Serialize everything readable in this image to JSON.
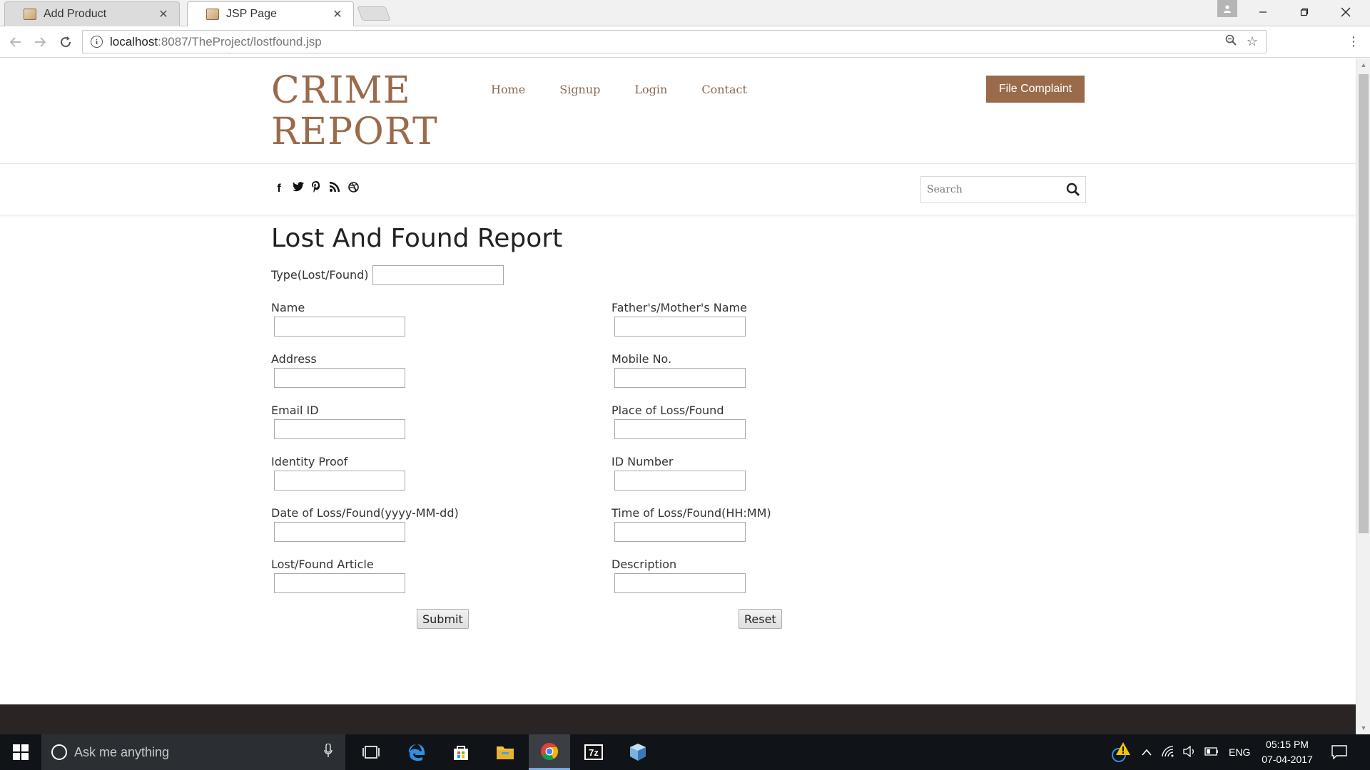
{
  "browser": {
    "tabs": [
      {
        "title": "Add Product",
        "active": false
      },
      {
        "title": "JSP Page",
        "active": true
      }
    ],
    "url_host": "localhost",
    "url_path": ":8087/TheProject/lostfound.jsp"
  },
  "site": {
    "logo_line1": "CRIME",
    "logo_line2": "REPORT",
    "nav": [
      "Home",
      "Signup",
      "Login",
      "Contact"
    ],
    "cta_label": "File Complaint",
    "search_placeholder": "Search",
    "social_icons": [
      "facebook-icon",
      "twitter-icon",
      "pinterest-icon",
      "rss-icon",
      "dribbble-icon"
    ]
  },
  "form": {
    "title": "Lost And Found Report",
    "type_label": "Type(Lost/Found)",
    "left_fields": [
      "Name",
      "Address",
      "Email ID",
      "Identity Proof",
      "Date of Loss/Found(yyyy-MM-dd)",
      "Lost/Found Article"
    ],
    "right_fields": [
      "Father's/Mother's Name",
      "Mobile No.",
      "Place of Loss/Found",
      "ID Number",
      "Time of Loss/Found(HH:MM)",
      "Description"
    ],
    "submit_label": "Submit",
    "reset_label": "Reset"
  },
  "taskbar": {
    "search_placeholder": "Ask me anything",
    "language": "ENG",
    "time": "05:15 PM",
    "date": "07-04-2017"
  },
  "colors": {
    "brand": "#9a6b4b",
    "footer": "#2b2425",
    "taskbar": "#101418"
  }
}
